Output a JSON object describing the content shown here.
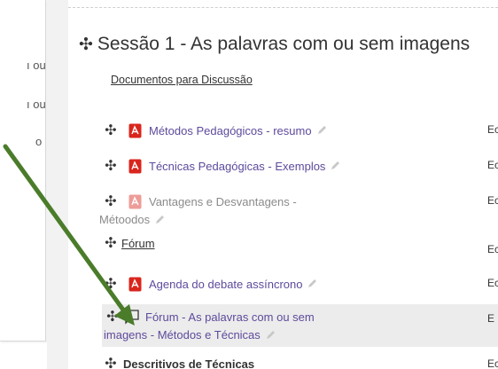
{
  "sidebar": {
    "fragments": [
      "ı ou",
      "ı ou",
      "o"
    ]
  },
  "section": {
    "title": "Sessão 1 - As palavras com ou sem imagens",
    "doc_link": "Documentos para Discussão"
  },
  "activities": [
    {
      "name": "Métodos Pedagógicos - resumo",
      "type": "pdf",
      "right": "Ec"
    },
    {
      "name": "Técnicas Pedagógicas - Exemplos",
      "type": "pdf",
      "right": "Ec"
    },
    {
      "name_line1": "Vantagens e Desvantagens -",
      "name_line2": "Métoodos",
      "type": "pdf-hidden",
      "right": "Ec"
    },
    {
      "name": "Fórum",
      "type": "forum-link",
      "right": "Ec"
    },
    {
      "name": "Agenda do debate assíncrono",
      "type": "pdf",
      "right": "Ec"
    },
    {
      "name_line1": "Fórum - As palavras com ou sem",
      "name_line2": "imagens - Métodos e Técnicas",
      "type": "forum",
      "right": "E"
    },
    {
      "name": "Descritivos  de Técnicas",
      "type": "label",
      "right": "Ec"
    }
  ],
  "colors": {
    "arrow": "#4a7c2a",
    "pdf_red": "#d9251c",
    "link": "#5e4a9c",
    "highlight": "#ececec"
  }
}
